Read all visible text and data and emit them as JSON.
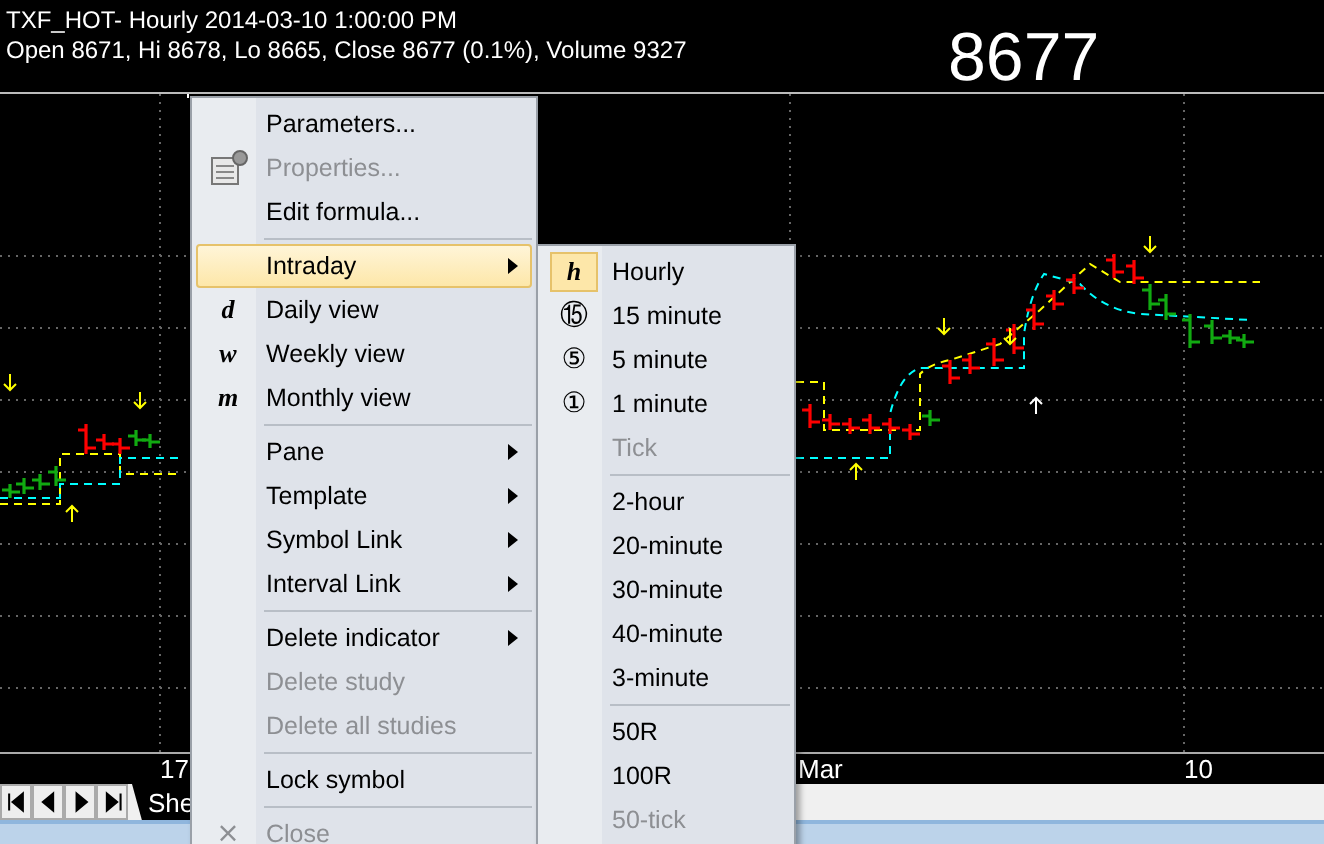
{
  "chart_header": {
    "title": "TXF_HOT- Hourly 2014-03-10 1:00:00 PM",
    "ohlc": "Open 8671, Hi 8678, Lo 8665, Close 8677 (0.1%), Volume 9327"
  },
  "last_price": "8677",
  "x_axis_labels": [
    "17",
    "Mar",
    "10"
  ],
  "sheet_tab": {
    "label": "She"
  },
  "context_menu": {
    "items": [
      {
        "kind": "item",
        "label": "Parameters...",
        "disabled": false,
        "submenu": false,
        "selected": false
      },
      {
        "kind": "icon-item",
        "label": "Properties...",
        "disabled": true,
        "submenu": false,
        "selected": false
      },
      {
        "kind": "item",
        "label": "Edit formula...",
        "disabled": false,
        "submenu": false,
        "selected": false
      },
      {
        "kind": "separator"
      },
      {
        "kind": "item",
        "label": "Intraday",
        "disabled": false,
        "submenu": true,
        "selected": true
      },
      {
        "kind": "item",
        "glyph": "d",
        "label": "Daily view",
        "disabled": false,
        "submenu": false,
        "selected": false
      },
      {
        "kind": "item",
        "glyph": "w",
        "label": "Weekly view",
        "disabled": false,
        "submenu": false,
        "selected": false
      },
      {
        "kind": "item",
        "glyph": "m",
        "label": "Monthly view",
        "disabled": false,
        "submenu": false,
        "selected": false
      },
      {
        "kind": "separator"
      },
      {
        "kind": "item",
        "label": "Pane",
        "disabled": false,
        "submenu": true,
        "selected": false
      },
      {
        "kind": "item",
        "label": "Template",
        "disabled": false,
        "submenu": true,
        "selected": false
      },
      {
        "kind": "item",
        "label": "Symbol Link",
        "disabled": false,
        "submenu": true,
        "selected": false
      },
      {
        "kind": "item",
        "label": "Interval Link",
        "disabled": false,
        "submenu": true,
        "selected": false
      },
      {
        "kind": "separator"
      },
      {
        "kind": "item",
        "label": "Delete indicator",
        "disabled": false,
        "submenu": true,
        "selected": false
      },
      {
        "kind": "item",
        "label": "Delete study",
        "disabled": true,
        "submenu": false,
        "selected": false
      },
      {
        "kind": "item",
        "label": "Delete all studies",
        "disabled": true,
        "submenu": false,
        "selected": false
      },
      {
        "kind": "separator"
      },
      {
        "kind": "item",
        "label": "Lock symbol",
        "disabled": false,
        "submenu": false,
        "selected": false
      },
      {
        "kind": "separator"
      },
      {
        "kind": "item",
        "glyph": "×",
        "label": "Close",
        "disabled": true,
        "submenu": false,
        "selected": false
      }
    ]
  },
  "intraday_submenu": {
    "items": [
      {
        "kind": "item",
        "glyph": "h",
        "label": "Hourly",
        "disabled": false,
        "selected": true
      },
      {
        "kind": "item",
        "glyph": "⑮",
        "label": "15 minute",
        "disabled": false,
        "selected": false
      },
      {
        "kind": "item",
        "glyph": "⑤",
        "label": "5 minute",
        "disabled": false,
        "selected": false
      },
      {
        "kind": "item",
        "glyph": "①",
        "label": "1 minute",
        "disabled": false,
        "selected": false
      },
      {
        "kind": "item",
        "label": "Tick",
        "disabled": true,
        "selected": false
      },
      {
        "kind": "separator"
      },
      {
        "kind": "item",
        "label": "2-hour",
        "disabled": false,
        "selected": false
      },
      {
        "kind": "item",
        "label": "20-minute",
        "disabled": false,
        "selected": false
      },
      {
        "kind": "item",
        "label": "30-minute",
        "disabled": false,
        "selected": false
      },
      {
        "kind": "item",
        "label": "40-minute",
        "disabled": false,
        "selected": false
      },
      {
        "kind": "item",
        "label": "3-minute",
        "disabled": false,
        "selected": false
      },
      {
        "kind": "separator"
      },
      {
        "kind": "item",
        "label": "50R",
        "disabled": false,
        "selected": false
      },
      {
        "kind": "item",
        "label": "100R",
        "disabled": false,
        "selected": false
      },
      {
        "kind": "item",
        "label": "50-tick",
        "disabled": true,
        "selected": false
      }
    ]
  }
}
